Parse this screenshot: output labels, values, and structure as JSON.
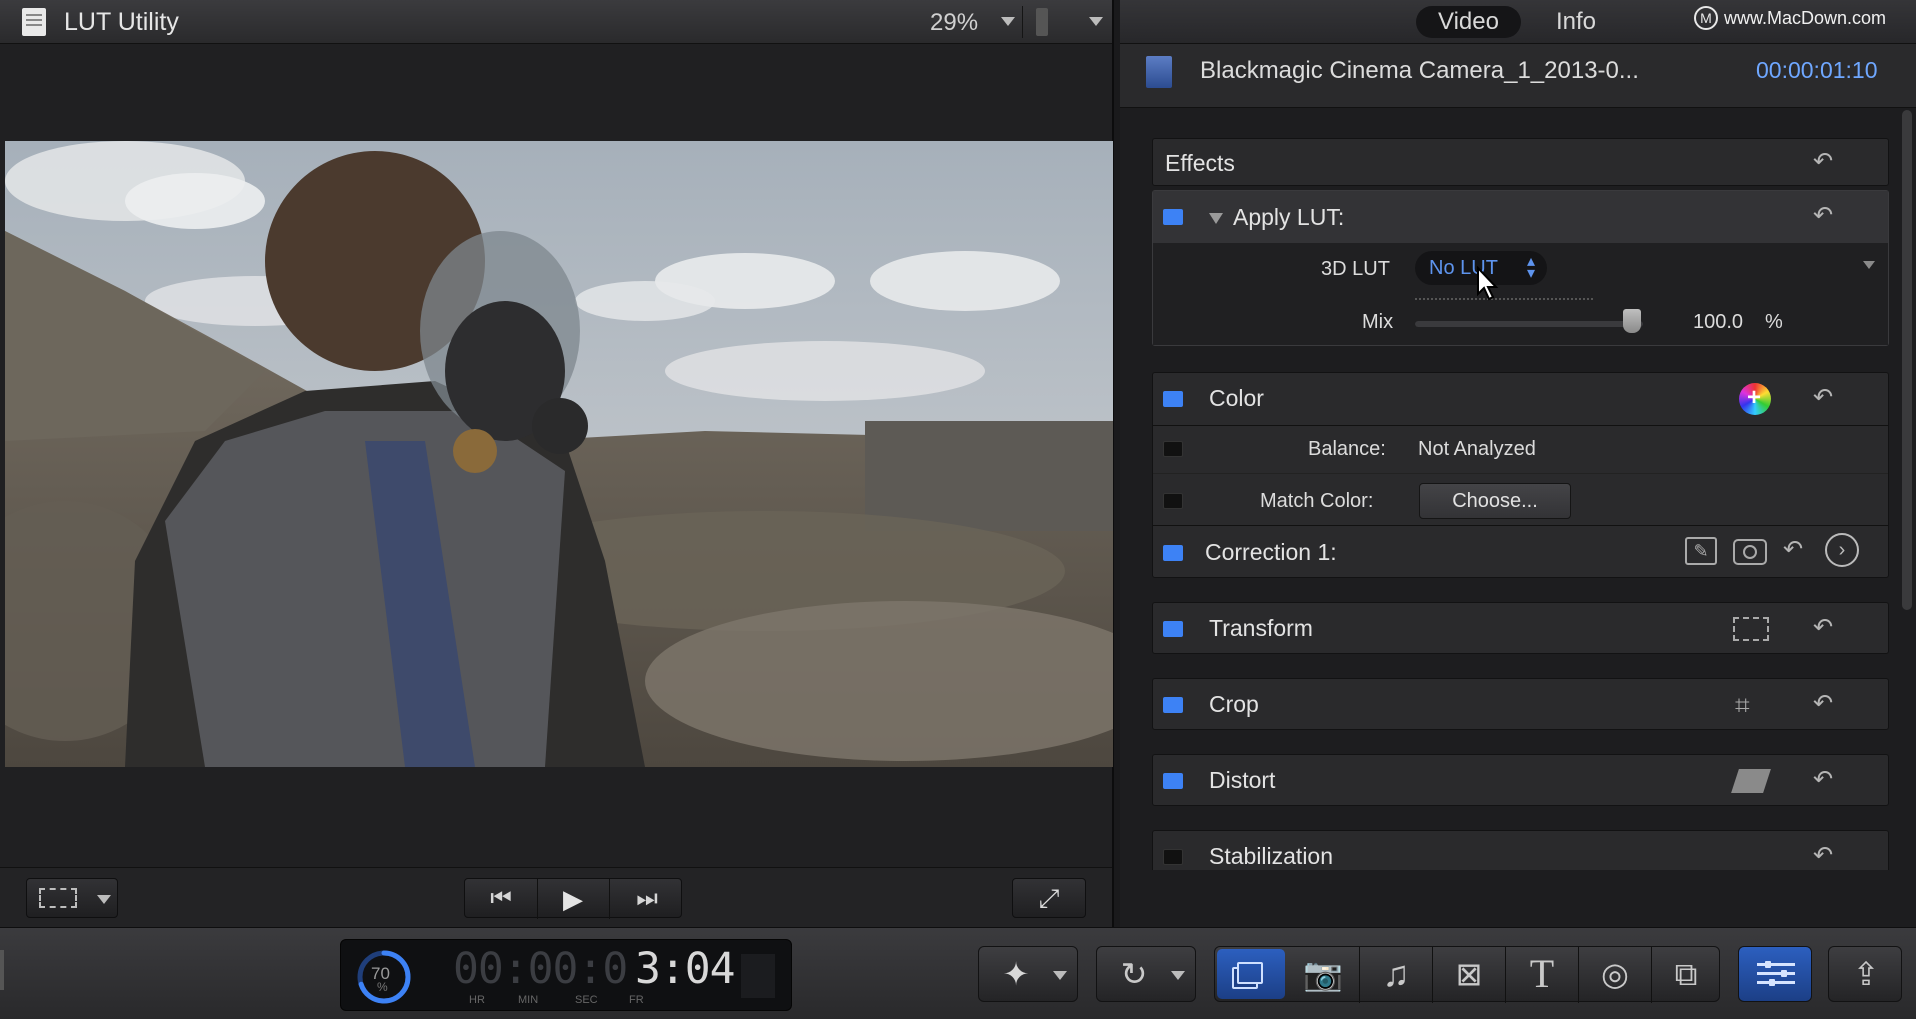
{
  "viewer": {
    "title": "LUT Utility",
    "zoom": "29%"
  },
  "inspector": {
    "tabs": [
      {
        "label": "Video",
        "active": true
      },
      {
        "label": "Info",
        "active": false
      }
    ],
    "clip_name": "Blackmagic Cinema Camera_1_2013-0...",
    "clip_timecode": "00:00:01:10",
    "effects_label": "Effects",
    "apply_lut": {
      "title": "Apply LUT:",
      "lut_label": "3D LUT",
      "lut_value": "No LUT",
      "mix_label": "Mix",
      "mix_value": "100.0",
      "mix_unit": "%",
      "mix_fraction": 1.0
    },
    "color": {
      "title": "Color",
      "balance_label": "Balance:",
      "balance_value": "Not Analyzed",
      "match_label": "Match Color:",
      "match_button": "Choose...",
      "correction_label": "Correction 1:"
    },
    "sections": [
      "Transform",
      "Crop",
      "Distort",
      "Stabilization"
    ]
  },
  "toolbar": {
    "timecode": {
      "progress_label": "70",
      "progress_unit": "%",
      "dim_digits": "00:00:0",
      "bright_digits": "3:04",
      "units": [
        "HR",
        "MIN",
        "SEC",
        "FR"
      ]
    }
  },
  "watermark": {
    "text": "www.MacDown.com"
  },
  "colors": {
    "accent_blue": "#3d82f5",
    "timecode_blue": "#6fa7ff",
    "panel_bg": "#2a2a2c"
  }
}
